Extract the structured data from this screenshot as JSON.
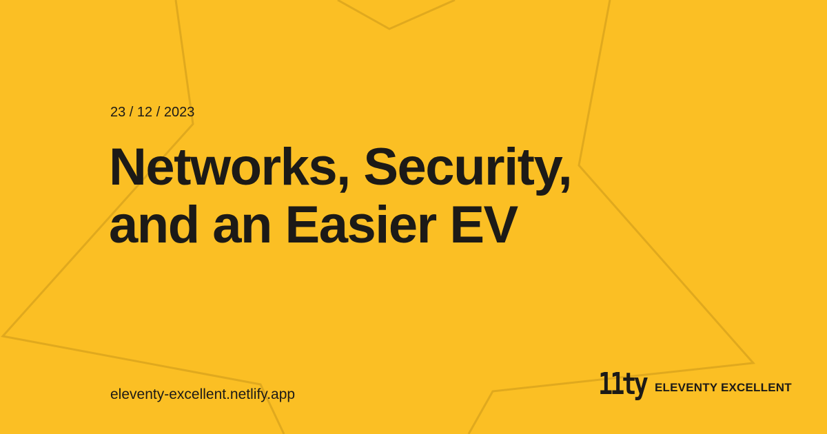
{
  "card": {
    "date": "23 / 12 / 2023",
    "title_lines": [
      "Networks, Security,",
      "and an Easier EV"
    ],
    "url": "eleventy-excellent.netlify.app",
    "logo_text": "11ty",
    "brand_name": "ELEVENTY EXCELLENT"
  },
  "colors": {
    "background": "#FBBF24",
    "text": "#1C1A17",
    "star_outline": "#E0A91E"
  }
}
